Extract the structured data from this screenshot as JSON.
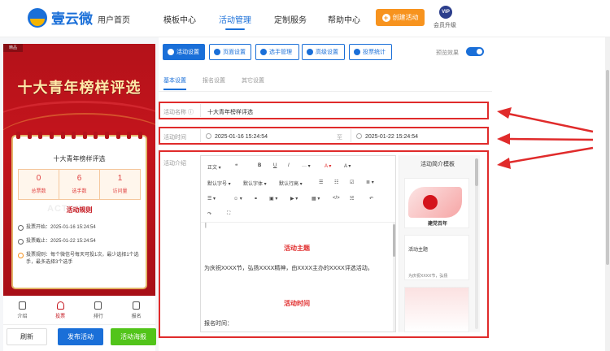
{
  "brand": {
    "name": "壹云微"
  },
  "nav": {
    "items": [
      "用户首页",
      "模板中心",
      "活动管理",
      "定制服务",
      "帮助中心"
    ],
    "create_label": "创建活动",
    "vip_badge": "VIP",
    "vip_label": "会员升级"
  },
  "preview": {
    "tag": "精品",
    "title": "十大青年榜样评选",
    "card_title": "十大青年榜样评选",
    "stats": [
      {
        "value": "0",
        "label": "总票数"
      },
      {
        "value": "6",
        "label": "选手数"
      },
      {
        "value": "1",
        "label": "访问量"
      }
    ],
    "rules_heading": "活动规则",
    "rules_heading_bg": "ACTIVE",
    "rule_start": "投票开始：2025-01-16 15:24:54",
    "rule_end": "投票截止：2025-01-22 15:24:54",
    "rule_desc": "投票规则：每个微信号每天可投1次，最少选择1个选手，最多选择3个选手",
    "tabs": [
      "介绍",
      "投票",
      "排行",
      "报名"
    ]
  },
  "bottom_buttons": {
    "refresh": "刷新",
    "publish": "发布活动",
    "poster": "活动海报"
  },
  "toolbar": {
    "activity_settings": "活动设置",
    "page_settings": "页面设置",
    "player_mgmt": "选手管理",
    "advanced_settings": "高级设置",
    "vote_stats": "投票统计",
    "preview_label": "预览效果",
    "preview_enabled": true
  },
  "subtabs": [
    "基本设置",
    "报名设置",
    "其它设置"
  ],
  "form": {
    "name_label": "活动名称 ⓘ",
    "name_value": "十大青年榜样评选",
    "time_label": "活动时间",
    "start_time": "2025-01-16 15:24:54",
    "time_sep": "至",
    "end_time": "2025-01-22 15:24:54",
    "intro_label": "活动介绍"
  },
  "editor": {
    "tools_row1": [
      "正文 ▾",
      "❝",
      "B",
      "U",
      "I",
      "··· ▾",
      "A ▾",
      "A ▾"
    ],
    "tools_row2": [
      "默认字号 ▾",
      "默认字体 ▾",
      "默认行高 ▾",
      "☰",
      "☷",
      "☑",
      "≣ ▾"
    ],
    "tools_row3": [
      "☰ ▾",
      "☺ ▾",
      "⚭",
      "▣ ▾",
      "▶ ▾",
      "▦ ▾",
      "</>",
      "☵",
      "↶"
    ],
    "tools_row4": [
      "↷",
      "⛶"
    ],
    "cursor": "|",
    "heading1": "活动主题",
    "paragraph1": "为庆祝XXXX节，弘扬XXXX精神，由XXXX主办的XXXX评选活动。",
    "heading2": "活动时间",
    "paragraph2": "报名时间："
  },
  "templates": {
    "title": "活动简介模板",
    "card1_text": "建党百年",
    "card2_title": "活动主题",
    "card2_text": "为庆祝XXXX节，弘扬"
  },
  "colors": {
    "accent": "#1a6fd8",
    "red": "#e02b2b",
    "orange": "#f7931e",
    "green": "#52c41a"
  }
}
